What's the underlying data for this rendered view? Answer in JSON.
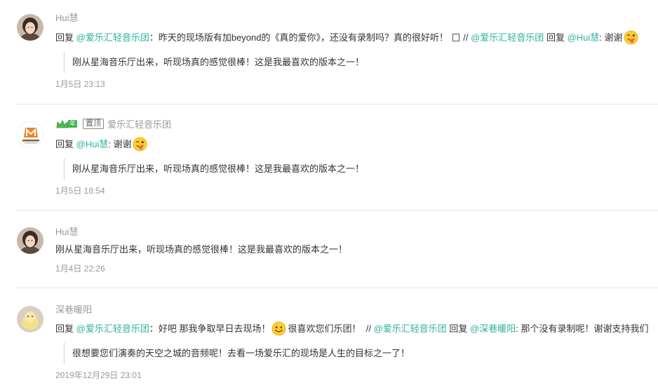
{
  "comments": [
    {
      "username": "Hui慧",
      "reply_prefix": "回复",
      "mention1": "@爱乐汇轻音乐团",
      "text1": "：昨天的现场版有加beyond的《真的爱你》，还没有录制吗？真的很好听！",
      "sep": "//",
      "mention2": "@爱乐汇轻音乐团",
      "reply2": "回复",
      "mention3": "@Hui慧",
      "text2": ": 谢谢",
      "quote": "刚从星海音乐厅出来，听现场真的感觉很棒！这是我最喜欢的版本之一！",
      "time": "1月5日 23:13"
    },
    {
      "username": "爱乐汇轻音乐团",
      "vip_year": "年",
      "badge": "置顶",
      "avatar_text": "爱乐汇轻音乐团",
      "reply_prefix": "回复",
      "mention1": "@Hui慧",
      "text1": ": 谢谢",
      "quote": "刚从星海音乐厅出来，听现场真的感觉很棒！这是我最喜欢的版本之一！",
      "time": "1月5日 18:54"
    },
    {
      "username": "Hui慧",
      "text1": "刚从星海音乐厅出来，听现场真的感觉很棒！这是我最喜欢的版本之一！",
      "time": "1月4日 22:26"
    },
    {
      "username": "深巷暖阳",
      "reply_prefix": "回复",
      "mention1": "@爱乐汇轻音乐团",
      "text1": "：好吧 那我争取早日去现场！",
      "text2": "很喜欢您们乐团！",
      "sep": "//",
      "mention2": "@爱乐汇轻音乐团",
      "reply2": "回复",
      "mention3": "@深巷暖阳",
      "text3": ": 那个没有录制呢！谢谢支持我们",
      "quote": "很想要您们演奏的天空之城的音频呢！去看一场爱乐汇的现场是人生的目标之一了！",
      "time": "2019年12月29日 23:01"
    }
  ],
  "colors": {
    "mention": "#2fb2a0",
    "meta": "#999999",
    "divider": "#e6e6e6"
  }
}
